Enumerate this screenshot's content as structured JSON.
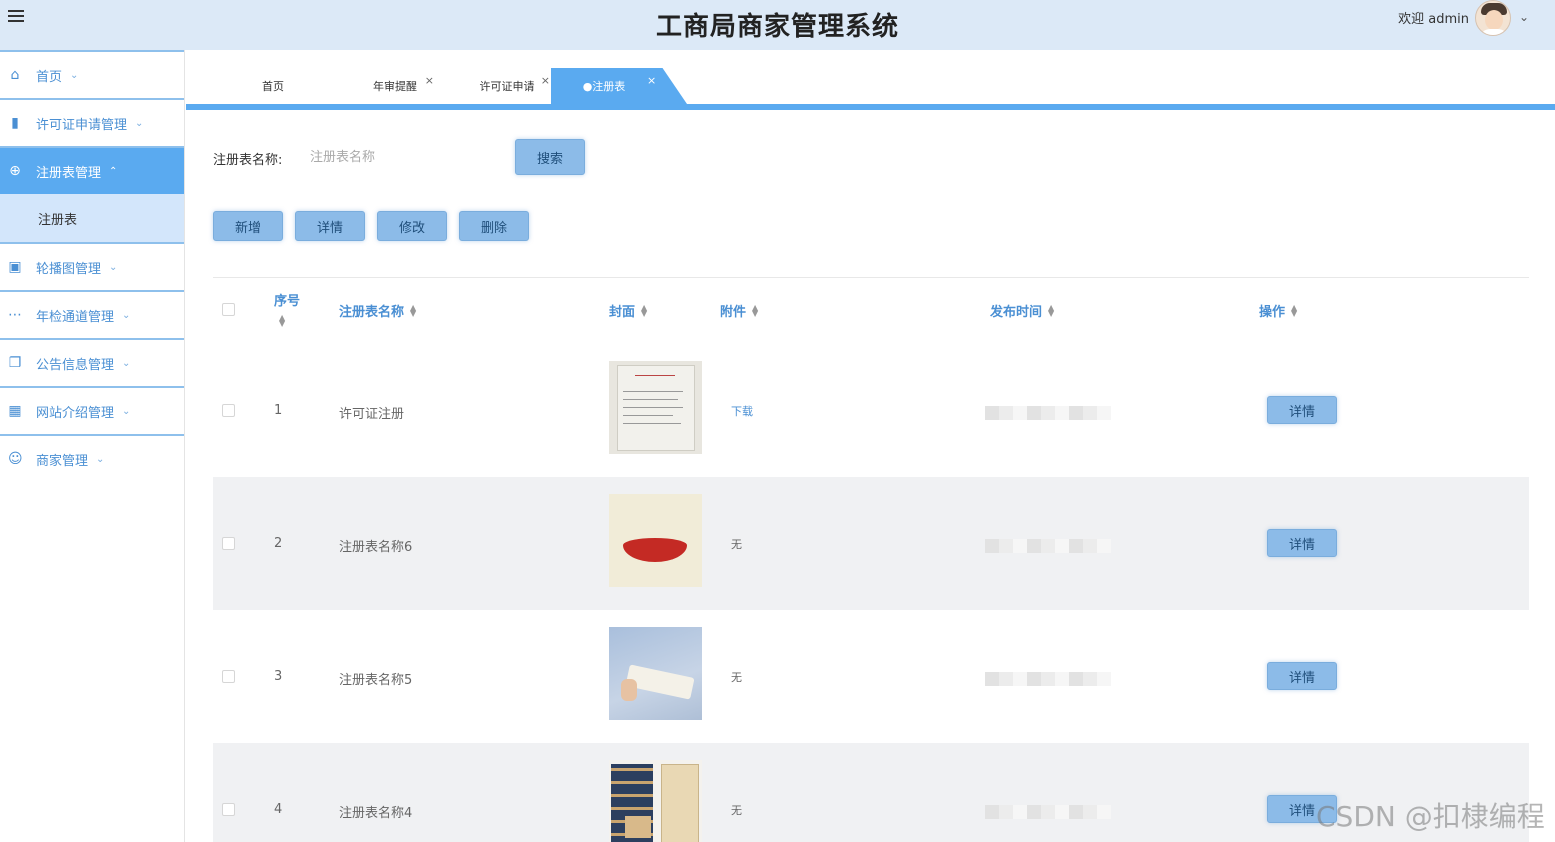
{
  "app": {
    "title": "工商局商家管理系统",
    "welcome": "欢迎 admin"
  },
  "sidebar": {
    "items": [
      {
        "label": "首页"
      },
      {
        "label": "许可证申请管理"
      },
      {
        "label": "注册表管理"
      },
      {
        "label": "轮播图管理"
      },
      {
        "label": "年检通道管理"
      },
      {
        "label": "公告信息管理"
      },
      {
        "label": "网站介绍管理"
      },
      {
        "label": "商家管理"
      }
    ],
    "active_submenu": "注册表"
  },
  "tabs": [
    {
      "label": "首页"
    },
    {
      "label": "年审提醒"
    },
    {
      "label": "许可证申请"
    },
    {
      "label": "●注册表"
    }
  ],
  "search": {
    "label": "注册表名称:",
    "placeholder": "注册表名称",
    "button": "搜索"
  },
  "toolbar": {
    "add": "新增",
    "detail": "详情",
    "edit": "修改",
    "delete": "删除"
  },
  "table": {
    "headers": {
      "index": "序号",
      "name": "注册表名称",
      "cover": "封面",
      "attachment": "附件",
      "publish_time": "发布时间",
      "actions": "操作"
    },
    "rows": [
      {
        "index": "1",
        "name": "许可证注册",
        "attachment": "下载",
        "action": "详情"
      },
      {
        "index": "2",
        "name": "注册表名称6",
        "attachment": "无",
        "action": "详情"
      },
      {
        "index": "3",
        "name": "注册表名称5",
        "attachment": "无",
        "action": "详情"
      },
      {
        "index": "4",
        "name": "注册表名称4",
        "attachment": "无",
        "action": "详情"
      }
    ]
  },
  "watermark": "CSDN @扣棣编程",
  "colors": {
    "header_bg": "#dce9f7",
    "accent": "#5aaaf0",
    "button": "#8cbbe8",
    "link": "#4a8fd3"
  }
}
